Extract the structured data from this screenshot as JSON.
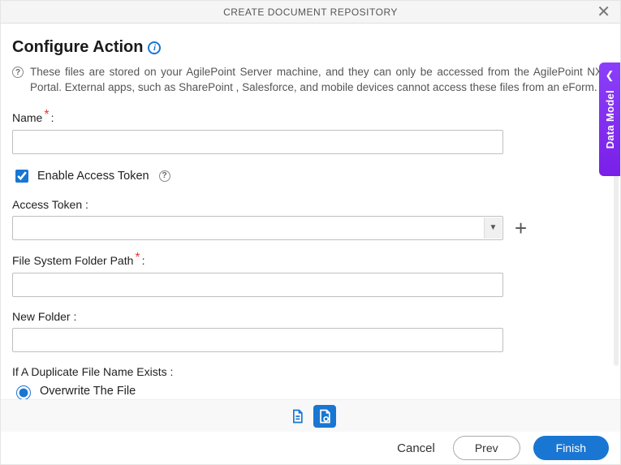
{
  "header": {
    "title": "CREATE DOCUMENT REPOSITORY"
  },
  "section": {
    "title": "Configure Action",
    "help_text": "These files are stored on your AgilePoint Server machine, and they can only be accessed from the AgilePoint NX Portal. External apps, such as SharePoint , Salesforce, and mobile devices cannot access these files from an eForm."
  },
  "fields": {
    "name_label": "Name",
    "name_value": "",
    "enable_access_token_label": "Enable Access Token",
    "enable_access_token_checked": true,
    "access_token_label": "Access Token :",
    "access_token_value": "",
    "folder_path_label": "File System Folder Path",
    "folder_path_value": "",
    "new_folder_label": "New Folder :",
    "new_folder_value": "",
    "duplicate_label": "If A Duplicate File Name Exists :",
    "overwrite_label": "Overwrite The File",
    "overwrite_selected": true
  },
  "side_panel": {
    "label": "Data Model"
  },
  "footer": {
    "cancel": "Cancel",
    "prev": "Prev",
    "finish": "Finish"
  }
}
